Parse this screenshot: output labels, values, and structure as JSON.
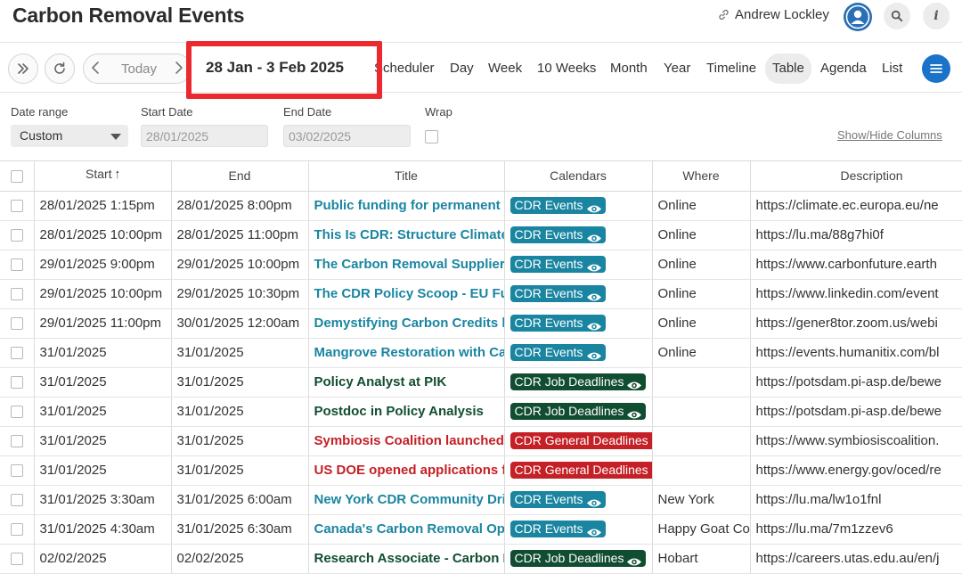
{
  "header": {
    "title": "Carbon Removal Events",
    "user_name": "Andrew Lockley"
  },
  "toolbar": {
    "today_label": "Today",
    "date_range_label": "28 Jan - 3 Feb 2025",
    "views": [
      "Scheduler",
      "Day",
      "Week",
      "10 Weeks",
      "Month",
      "Year",
      "Timeline",
      "Table",
      "Agenda",
      "List"
    ],
    "active_view": "Table"
  },
  "filters": {
    "date_range_label": "Date range",
    "date_range_value": "Custom",
    "start_date_label": "Start Date",
    "start_date_value": "28/01/2025",
    "end_date_label": "End Date",
    "end_date_value": "03/02/2025",
    "wrap_label": "Wrap",
    "show_hide_label": "Show/Hide Columns"
  },
  "table": {
    "columns": [
      "Start",
      "End",
      "Title",
      "Calendars",
      "Where",
      "Description"
    ],
    "rows": [
      {
        "start": "28/01/2025 1:15pm",
        "end": "28/01/2025 8:00pm",
        "title": "Public funding for permanent c",
        "calendar": "CDR Events",
        "where": "Online",
        "description": "https://climate.ec.europa.eu/ne"
      },
      {
        "start": "28/01/2025 10:00pm",
        "end": "28/01/2025 11:00pm",
        "title": "This Is CDR: Structure Climate",
        "calendar": "CDR Events",
        "where": "Online",
        "description": "https://lu.ma/88g7hi0f"
      },
      {
        "start": "29/01/2025 9:00pm",
        "end": "29/01/2025 10:00pm",
        "title": "The Carbon Removal Supplier's",
        "calendar": "CDR Events",
        "where": "Online",
        "description": "https://www.carbonfuture.earth"
      },
      {
        "start": "29/01/2025 10:00pm",
        "end": "29/01/2025 10:30pm",
        "title": "The CDR Policy Scoop - EU Fun",
        "calendar": "CDR Events",
        "where": "Online",
        "description": "https://www.linkedin.com/event"
      },
      {
        "start": "29/01/2025 11:00pm",
        "end": "30/01/2025 12:00am",
        "title": "Demystifying Carbon Credits b",
        "calendar": "CDR Events",
        "where": "Online",
        "description": "https://gener8tor.zoom.us/webi"
      },
      {
        "start": "31/01/2025",
        "end": "31/01/2025",
        "title": "Mangrove Restoration with Car",
        "calendar": "CDR Events",
        "where": "Online",
        "description": "https://events.humanitix.com/bl"
      },
      {
        "start": "31/01/2025",
        "end": "31/01/2025",
        "title": "Policy Analyst at PIK",
        "calendar": "CDR Job Deadlines",
        "where": "",
        "description": "https://potsdam.pi-asp.de/bewe"
      },
      {
        "start": "31/01/2025",
        "end": "31/01/2025",
        "title": "Postdoc in Policy Analysis",
        "calendar": "CDR Job Deadlines",
        "where": "",
        "description": "https://potsdam.pi-asp.de/bewe"
      },
      {
        "start": "31/01/2025",
        "end": "31/01/2025",
        "title": "Symbiosis Coalition launched f",
        "calendar": "CDR General Deadlines",
        "where": "",
        "description": "https://www.symbiosiscoalition."
      },
      {
        "start": "31/01/2025",
        "end": "31/01/2025",
        "title": "US DOE opened applications fo",
        "calendar": "CDR General Deadlines",
        "where": "",
        "description": "https://www.energy.gov/oced/re"
      },
      {
        "start": "31/01/2025 3:30am",
        "end": "31/01/2025 6:00am",
        "title": "New York CDR Community Drin",
        "calendar": "CDR Events",
        "where": "New York",
        "description": "https://lu.ma/lw1o1fnl"
      },
      {
        "start": "31/01/2025 4:30am",
        "end": "31/01/2025 6:30am",
        "title": "Canada's Carbon Removal Opp",
        "calendar": "CDR Events",
        "where": "Happy Goat Co",
        "description": "https://lu.ma/7m1zzev6"
      },
      {
        "start": "02/02/2025",
        "end": "02/02/2025",
        "title": "Research Associate - Carbon B",
        "calendar": "CDR Job Deadlines",
        "where": "Hobart",
        "description": "https://careers.utas.edu.au/en/j"
      }
    ]
  },
  "calendar_colors": {
    "CDR Events": "#1a85a1",
    "CDR Job Deadlines": "#114d31",
    "CDR General Deadlines": "#c42026"
  },
  "title_colors": {
    "CDR Events": "#1a85a1",
    "CDR Job Deadlines": "#114d31",
    "CDR General Deadlines": "#c42026"
  },
  "icons": {
    "header": [
      "link-icon",
      "user-avatar-icon",
      "search-icon",
      "info-icon"
    ],
    "toolbar": [
      "double-chevron-right-icon",
      "refresh-icon",
      "chevron-left-icon",
      "chevron-right-icon",
      "hamburger-menu-icon"
    ],
    "calendar_badge": "eye-icon"
  }
}
